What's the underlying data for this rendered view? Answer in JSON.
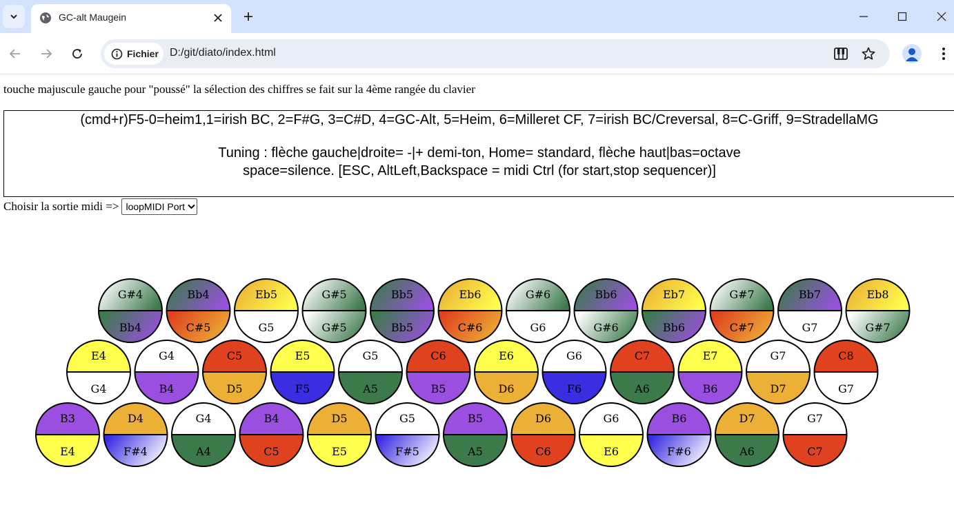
{
  "browser": {
    "tab_title": "GC-alt Maugein",
    "security_chip": "Fichier",
    "url": "D:/git/diato/index.html"
  },
  "page": {
    "instructions": "touche majuscule gauche pour \"poussé\" la sélection des chiffres se fait sur la 4ème rangée du clavier",
    "info_line1": "(cmd+r)F5-0=heim1,1=irish BC, 2=F#G, 3=C#D, 4=GC-Alt, 5=Heim, 6=Milleret CF, 7=irish BC/Creversal, 8=C-Griff, 9=StradellaMG",
    "info_line2": "Tuning : flèche gauche|droite= -|+ demi-ton, Home= standard, flèche haut|bas=octave",
    "info_line3": "space=silence. [ESC, AltLeft,Backspace = midi Ctrl (for start,stop sequencer)]",
    "midi_label": "Choisir la sortie midi =>",
    "midi_selected": "loopMIDI Port"
  },
  "colors": {
    "white": "#ffffff",
    "yellow": "#ffff4d",
    "purple": "#9b4fe0",
    "red": "#e0421f",
    "orange": "#ecb036",
    "blue": "#3a2ee0",
    "green": "#3c7a4c"
  },
  "rows": [
    {
      "buttons": [
        {
          "top": "G#4",
          "bottom": "Bb4",
          "top_fill": "g_ws_green",
          "bottom_fill": "g_green_purple"
        },
        {
          "top": "Bb4",
          "bottom": "C#5",
          "top_fill": "g_green_purple",
          "bottom_fill": "g_red_orange"
        },
        {
          "top": "Eb5",
          "bottom": "G5",
          "top_fill": "g_orange_yellow",
          "bottom_fill": "white"
        },
        {
          "top": "G#5",
          "bottom": "G#5",
          "top_fill": "g_ws_green",
          "bottom_fill": "g_ws_green"
        },
        {
          "top": "Bb5",
          "bottom": "Bb5",
          "top_fill": "g_green_purple",
          "bottom_fill": "g_green_purple"
        },
        {
          "top": "Eb6",
          "bottom": "C#6",
          "top_fill": "g_orange_yellow",
          "bottom_fill": "g_red_orange"
        },
        {
          "top": "G#6",
          "bottom": "G6",
          "top_fill": "g_ws_green",
          "bottom_fill": "white"
        },
        {
          "top": "Bb6",
          "bottom": "G#6",
          "top_fill": "g_green_purple",
          "bottom_fill": "g_ws_green"
        },
        {
          "top": "Eb7",
          "bottom": "Bb6",
          "top_fill": "g_orange_yellow",
          "bottom_fill": "g_green_purple"
        },
        {
          "top": "G#7",
          "bottom": "C#7",
          "top_fill": "g_ws_green",
          "bottom_fill": "g_red_orange"
        },
        {
          "top": "Bb7",
          "bottom": "G7",
          "top_fill": "g_green_purple",
          "bottom_fill": "white"
        },
        {
          "top": "Eb8",
          "bottom": "G#7",
          "top_fill": "g_orange_yellow",
          "bottom_fill": "g_ws_green"
        }
      ]
    },
    {
      "buttons": [
        {
          "top": "E4",
          "bottom": "G4",
          "top_fill": "yellow",
          "bottom_fill": "white"
        },
        {
          "top": "G4",
          "bottom": "B4",
          "top_fill": "white",
          "bottom_fill": "purple"
        },
        {
          "top": "C5",
          "bottom": "D5",
          "top_fill": "red",
          "bottom_fill": "orange"
        },
        {
          "top": "E5",
          "bottom": "F5",
          "top_fill": "yellow",
          "bottom_fill": "blue"
        },
        {
          "top": "G5",
          "bottom": "A5",
          "top_fill": "white",
          "bottom_fill": "green"
        },
        {
          "top": "C6",
          "bottom": "B5",
          "top_fill": "red",
          "bottom_fill": "purple"
        },
        {
          "top": "E6",
          "bottom": "D6",
          "top_fill": "yellow",
          "bottom_fill": "orange"
        },
        {
          "top": "G6",
          "bottom": "F6",
          "top_fill": "white",
          "bottom_fill": "blue"
        },
        {
          "top": "C7",
          "bottom": "A6",
          "top_fill": "red",
          "bottom_fill": "green"
        },
        {
          "top": "E7",
          "bottom": "B6",
          "top_fill": "yellow",
          "bottom_fill": "purple"
        },
        {
          "top": "G7",
          "bottom": "D7",
          "top_fill": "white",
          "bottom_fill": "orange"
        },
        {
          "top": "C8",
          "bottom": "G7",
          "top_fill": "red",
          "bottom_fill": "white"
        }
      ]
    },
    {
      "buttons": [
        {
          "top": "B3",
          "bottom": "E4",
          "top_fill": "purple",
          "bottom_fill": "yellow"
        },
        {
          "top": "D4",
          "bottom": "F#4",
          "top_fill": "orange",
          "bottom_fill": "g_blue_white"
        },
        {
          "top": "G4",
          "bottom": "A4",
          "top_fill": "white",
          "bottom_fill": "green"
        },
        {
          "top": "B4",
          "bottom": "C5",
          "top_fill": "purple",
          "bottom_fill": "red"
        },
        {
          "top": "D5",
          "bottom": "E5",
          "top_fill": "orange",
          "bottom_fill": "yellow"
        },
        {
          "top": "G5",
          "bottom": "F#5",
          "top_fill": "white",
          "bottom_fill": "g_blue_white"
        },
        {
          "top": "B5",
          "bottom": "A5",
          "top_fill": "purple",
          "bottom_fill": "green"
        },
        {
          "top": "D6",
          "bottom": "C6",
          "top_fill": "orange",
          "bottom_fill": "red"
        },
        {
          "top": "G6",
          "bottom": "E6",
          "top_fill": "white",
          "bottom_fill": "yellow"
        },
        {
          "top": "B6",
          "bottom": "F#6",
          "top_fill": "purple",
          "bottom_fill": "g_blue_white"
        },
        {
          "top": "D7",
          "bottom": "A6",
          "top_fill": "orange",
          "bottom_fill": "green"
        },
        {
          "top": "G7",
          "bottom": "C7",
          "top_fill": "white",
          "bottom_fill": "red"
        }
      ]
    }
  ]
}
